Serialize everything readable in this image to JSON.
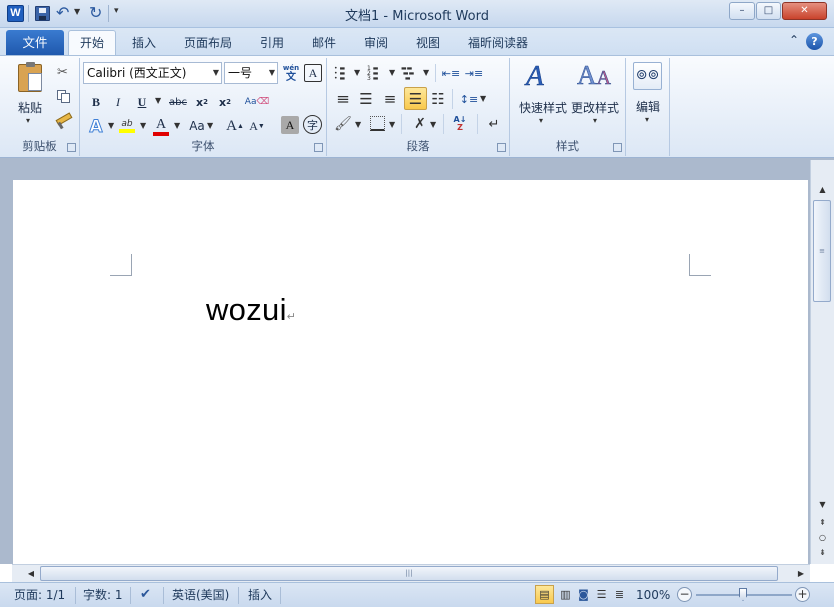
{
  "title": "文档1 - Microsoft Word",
  "window_buttons": {
    "minimize": "–",
    "maximize": "□",
    "close": "✕"
  },
  "tabs": {
    "file": "文件",
    "home": "开始",
    "insert": "插入",
    "layout": "页面布局",
    "references": "引用",
    "mailings": "邮件",
    "review": "审阅",
    "view": "视图",
    "foxit": "福昕阅读器"
  },
  "clipboard": {
    "paste": "粘贴",
    "label": "剪贴板"
  },
  "font": {
    "name": "Calibri (西文正文)",
    "size": "一号",
    "label": "字体"
  },
  "paragraph": {
    "label": "段落"
  },
  "styles": {
    "quick": "快速样式",
    "change": "更改样式",
    "label": "样式"
  },
  "editing": {
    "label": "编辑"
  },
  "document": {
    "text": "wozui"
  },
  "status": {
    "page": "页面: 1/1",
    "words": "字数: 1",
    "language": "英语(美国)",
    "mode": "插入",
    "zoom": "100%"
  },
  "colors": {
    "accent": "#2b579a",
    "ribbon_bg": "#dce7f5",
    "doc_bg": "#abb9cd",
    "highlight": "#ffff00",
    "font_color": "#e00000",
    "active_button": "#fbd86b"
  }
}
